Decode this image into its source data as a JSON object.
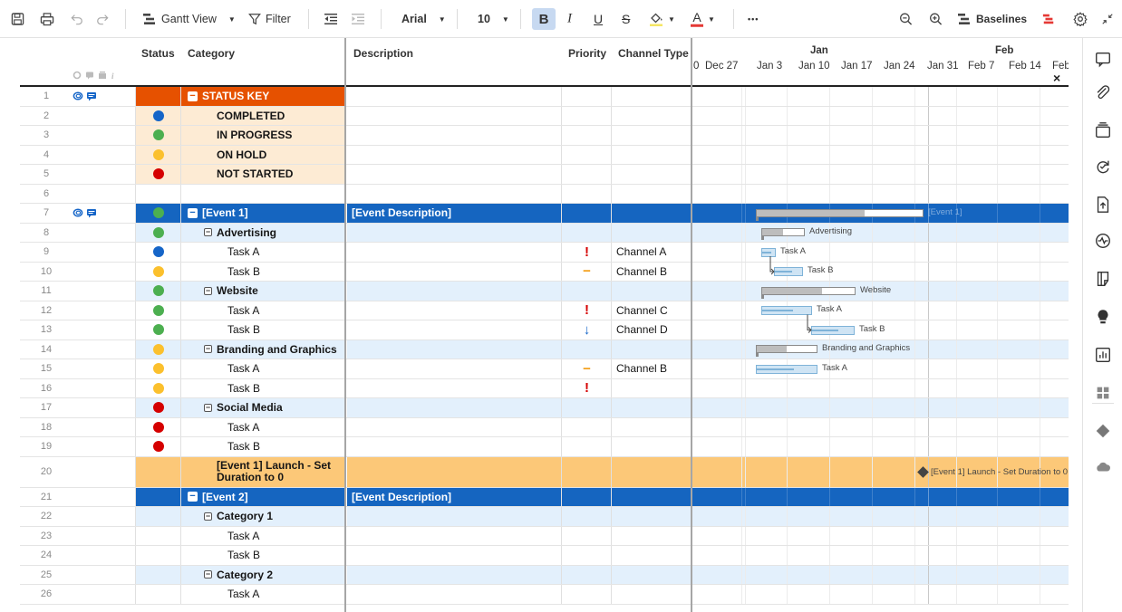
{
  "toolbar": {
    "gantt_label": "Gantt View",
    "filter_label": "Filter",
    "font": "Arial",
    "font_size": "10",
    "bold": "B",
    "italic": "I",
    "underline": "U",
    "strike": "S",
    "text_color": "A",
    "more": "•••",
    "baselines": "Baselines"
  },
  "columns": {
    "status": "Status",
    "category": "Category",
    "description": "Description",
    "priority": "Priority",
    "channel": "Channel Type"
  },
  "timeline": {
    "months": [
      {
        "label": "Jan"
      },
      {
        "label": "Feb"
      }
    ],
    "weeks": [
      "0",
      "Dec 27",
      "Jan 3",
      "Jan 10",
      "Jan 17",
      "Jan 24",
      "Jan 31",
      "Feb 7",
      "Feb 14",
      "Feb"
    ],
    "close": "×"
  },
  "colors": {
    "blue": "#1565c8",
    "green": "#4caf50",
    "yellow": "#fbc02d",
    "red": "#d50000",
    "orange": "#e65100",
    "event": "#1565c0",
    "sub": "#e3f0fc",
    "key_bg": "#fdebd4",
    "launch": "#fcc878"
  },
  "rows": [
    {
      "n": "1",
      "type": "keyhead",
      "category": "STATUS KEY",
      "icons": true
    },
    {
      "n": "2",
      "type": "key",
      "status": "blue",
      "category": "COMPLETED"
    },
    {
      "n": "3",
      "type": "key",
      "status": "green",
      "category": "IN PROGRESS"
    },
    {
      "n": "4",
      "type": "key",
      "status": "yellow",
      "category": "ON HOLD"
    },
    {
      "n": "5",
      "type": "key",
      "status": "red",
      "category": "NOT STARTED"
    },
    {
      "n": "6",
      "type": "blank"
    },
    {
      "n": "7",
      "type": "event",
      "status": "green",
      "category": "[Event 1]",
      "description": "[Event Description]",
      "icons": true
    },
    {
      "n": "8",
      "type": "sub",
      "status": "green",
      "category": "Advertising"
    },
    {
      "n": "9",
      "type": "task",
      "status": "blue",
      "category": "Task A",
      "priority": "!",
      "channel": "Channel A"
    },
    {
      "n": "10",
      "type": "task",
      "status": "yellow",
      "category": "Task B",
      "priority": "−",
      "channel": "Channel B"
    },
    {
      "n": "11",
      "type": "sub",
      "status": "green",
      "category": "Website"
    },
    {
      "n": "12",
      "type": "task",
      "status": "green",
      "category": "Task A",
      "priority": "!",
      "channel": "Channel C"
    },
    {
      "n": "13",
      "type": "task",
      "status": "green",
      "category": "Task B",
      "priority": "↓",
      "channel": "Channel D"
    },
    {
      "n": "14",
      "type": "sub",
      "status": "yellow",
      "category": "Branding and Graphics"
    },
    {
      "n": "15",
      "type": "task",
      "status": "yellow",
      "category": "Task A",
      "priority": "−",
      "channel": "Channel B"
    },
    {
      "n": "16",
      "type": "task",
      "status": "yellow",
      "category": "Task B",
      "priority": "!"
    },
    {
      "n": "17",
      "type": "sub",
      "status": "red",
      "category": "Social Media"
    },
    {
      "n": "18",
      "type": "task",
      "status": "red",
      "category": "Task A"
    },
    {
      "n": "19",
      "type": "task",
      "status": "red",
      "category": "Task B"
    },
    {
      "n": "20",
      "type": "launch",
      "category": "[Event 1] Launch - Set Duration to 0"
    },
    {
      "n": "21",
      "type": "event",
      "category": "[Event 2]",
      "description": "[Event Description]"
    },
    {
      "n": "22",
      "type": "sub",
      "category": "Category 1"
    },
    {
      "n": "23",
      "type": "task",
      "category": "Task A"
    },
    {
      "n": "24",
      "type": "task",
      "category": "Task B"
    },
    {
      "n": "25",
      "type": "sub",
      "category": "Category 2"
    },
    {
      "n": "26",
      "type": "task",
      "category": "Task A"
    }
  ],
  "gantt": [
    {
      "row": "7",
      "label": "[Event 1]",
      "kind": "summary",
      "progress": 0.65
    },
    {
      "row": "8",
      "label": "Advertising",
      "kind": "summary",
      "progress": 0.5
    },
    {
      "row": "9",
      "label": "Task A",
      "kind": "task"
    },
    {
      "row": "10",
      "label": "Task B",
      "kind": "task"
    },
    {
      "row": "11",
      "label": "Website",
      "kind": "summary",
      "progress": 0.65
    },
    {
      "row": "12",
      "label": "Task A",
      "kind": "task"
    },
    {
      "row": "13",
      "label": "Task B",
      "kind": "task"
    },
    {
      "row": "14",
      "label": "Branding and Graphics",
      "kind": "summary",
      "progress": 0.5
    },
    {
      "row": "15",
      "label": "Task A",
      "kind": "task"
    },
    {
      "row": "20",
      "label": "[Event 1] Launch - Set Duration to 0",
      "kind": "milestone"
    }
  ],
  "rail_icons": [
    "comment-icon",
    "attachment-icon",
    "proofs-icon",
    "update-requests-icon",
    "publish-icon",
    "activity-log-icon",
    "summary-icon",
    "bulb-icon",
    "report-icon",
    "apps-icon",
    "diamond-icon",
    "cloud-icon"
  ]
}
